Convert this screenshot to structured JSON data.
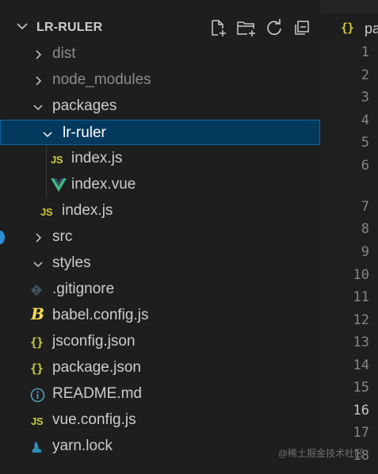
{
  "explorer": {
    "project_title": "LR-RULER",
    "actions": [
      "new-file-icon",
      "new-folder-icon",
      "refresh-icon",
      "collapse-all-icon"
    ],
    "items": [
      {
        "label": "dist",
        "type": "folder",
        "state": "collapsed",
        "dimmed": true
      },
      {
        "label": "node_modules",
        "type": "folder",
        "state": "collapsed",
        "dimmed": true
      },
      {
        "label": "packages",
        "type": "folder",
        "state": "expanded"
      },
      {
        "label": "lr-ruler",
        "type": "folder",
        "state": "expanded",
        "selected": true
      },
      {
        "label": "index.js",
        "type": "file",
        "icon": "JS"
      },
      {
        "label": "index.vue",
        "type": "file",
        "icon": "vue-icon"
      },
      {
        "label": "index.js",
        "type": "file",
        "icon": "JS"
      },
      {
        "label": "src",
        "type": "folder",
        "state": "collapsed"
      },
      {
        "label": "styles",
        "type": "folder",
        "state": "expanded"
      },
      {
        "label": ".gitignore",
        "type": "file",
        "icon": "git-icon"
      },
      {
        "label": "babel.config.js",
        "type": "file",
        "icon": "babel-icon"
      },
      {
        "label": "jsconfig.json",
        "type": "file",
        "icon": "{}"
      },
      {
        "label": "package.json",
        "type": "file",
        "icon": "{}"
      },
      {
        "label": "README.md",
        "type": "file",
        "icon": "info-icon"
      },
      {
        "label": "vue.config.js",
        "type": "file",
        "icon": "JS"
      },
      {
        "label": "yarn.lock",
        "type": "file",
        "icon": "yarn-icon"
      }
    ]
  },
  "editor": {
    "tab_icon": "{}",
    "tab_label": "pa",
    "line_numbers": [
      "1",
      "2",
      "3",
      "4",
      "5",
      "6",
      "7",
      "8",
      "9",
      "10",
      "11",
      "12",
      "13",
      "14",
      "15",
      "16",
      "17",
      "18"
    ],
    "current_line": "16"
  },
  "watermark": "@稀土掘金技术社区",
  "colors": {
    "selection_bg": "#04395e",
    "selection_border": "#0e639c",
    "js_yellow": "#cbcb41",
    "vue_green": "#41b883",
    "info_blue": "#519aba"
  }
}
